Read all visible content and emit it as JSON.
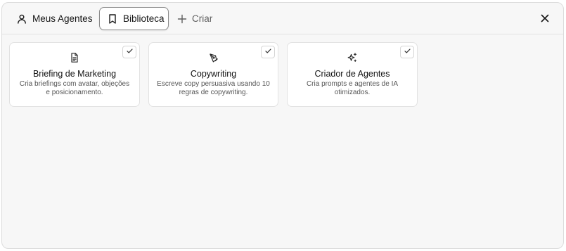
{
  "tabs": [
    {
      "label": "Meus Agentes",
      "icon": "user-icon",
      "active": false
    },
    {
      "label": "Biblioteca",
      "icon": "bookmark-icon",
      "active": true
    },
    {
      "label": "Criar",
      "icon": "plus-icon",
      "active": false
    }
  ],
  "close_icon": "close-icon",
  "cards": [
    {
      "title": "Briefing de Marketing",
      "description": "Cria briefings com avatar, objeções e posicionamento.",
      "icon": "document-icon",
      "selected": true
    },
    {
      "title": "Copywriting",
      "description": "Escreve copy persuasiva usando 10 regras de copywriting.",
      "icon": "pen-tool-icon",
      "selected": true
    },
    {
      "title": "Criador de Agentes",
      "description": "Cria prompts e agentes de IA otimizados.",
      "icon": "sparkles-icon",
      "selected": true
    }
  ],
  "colors": {
    "panel_background": "#f7f7f7",
    "card_background": "#ffffff",
    "border": "#dcdcdc",
    "active_tab_border": "#8a8a8a"
  }
}
